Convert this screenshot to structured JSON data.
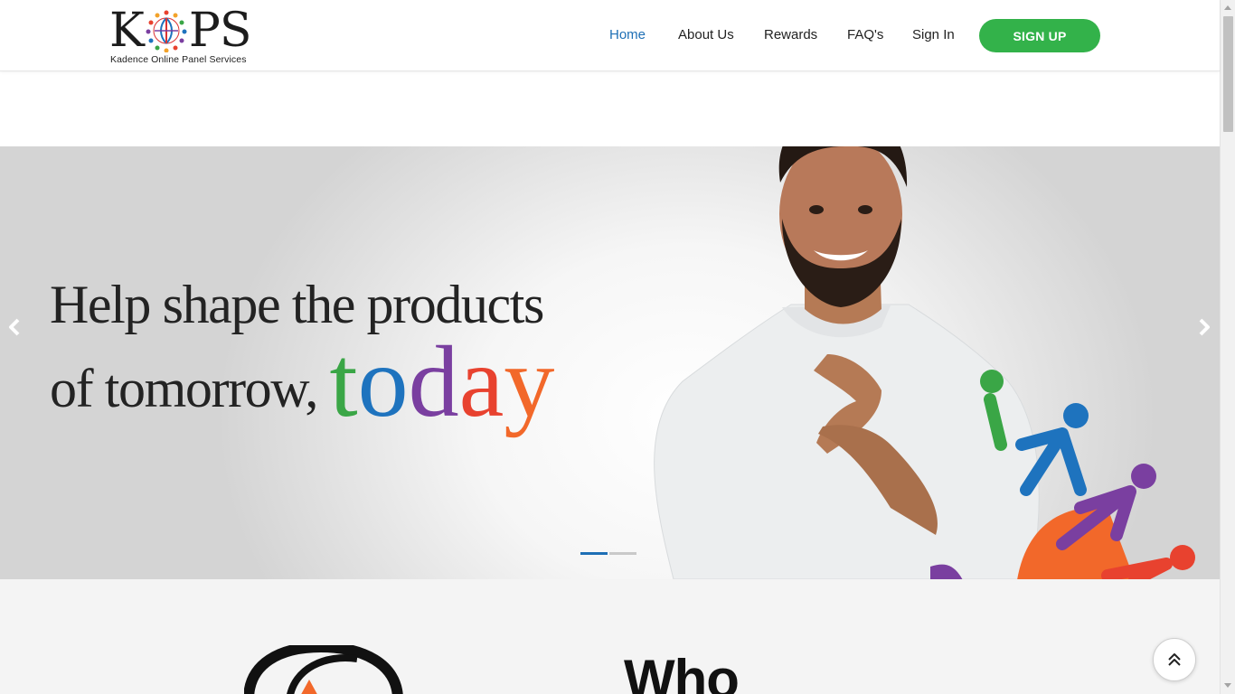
{
  "brand": {
    "logo_letters_left": "K",
    "logo_letters_right": "PS",
    "tagline": "Kadence Online Panel Services"
  },
  "nav": {
    "items": [
      {
        "label": "Home",
        "active": true
      },
      {
        "label": "About Us",
        "active": false
      },
      {
        "label": "Rewards",
        "active": false
      },
      {
        "label": "FAQ's",
        "active": false
      },
      {
        "label": "Sign In",
        "active": false
      }
    ],
    "signup_label": "SIGN UP"
  },
  "hero": {
    "headline_line1": "Help shape the products",
    "headline_line2": "of tomorrow,",
    "headline_accent": [
      "t",
      "o",
      "d",
      "a",
      "y"
    ],
    "slide_count": 2,
    "active_slide": 1,
    "accent_colors": [
      "#3aa646",
      "#1e73be",
      "#7a3fa0",
      "#e8422f",
      "#f2682a"
    ]
  },
  "section": {
    "heading": "Who"
  },
  "colors": {
    "primary": "#1e6fb5",
    "signup_green": "#33b24a"
  },
  "icons": {
    "prev": "chevron-left-icon",
    "next": "chevron-right-icon",
    "scroll_top": "double-chevron-up-icon"
  }
}
